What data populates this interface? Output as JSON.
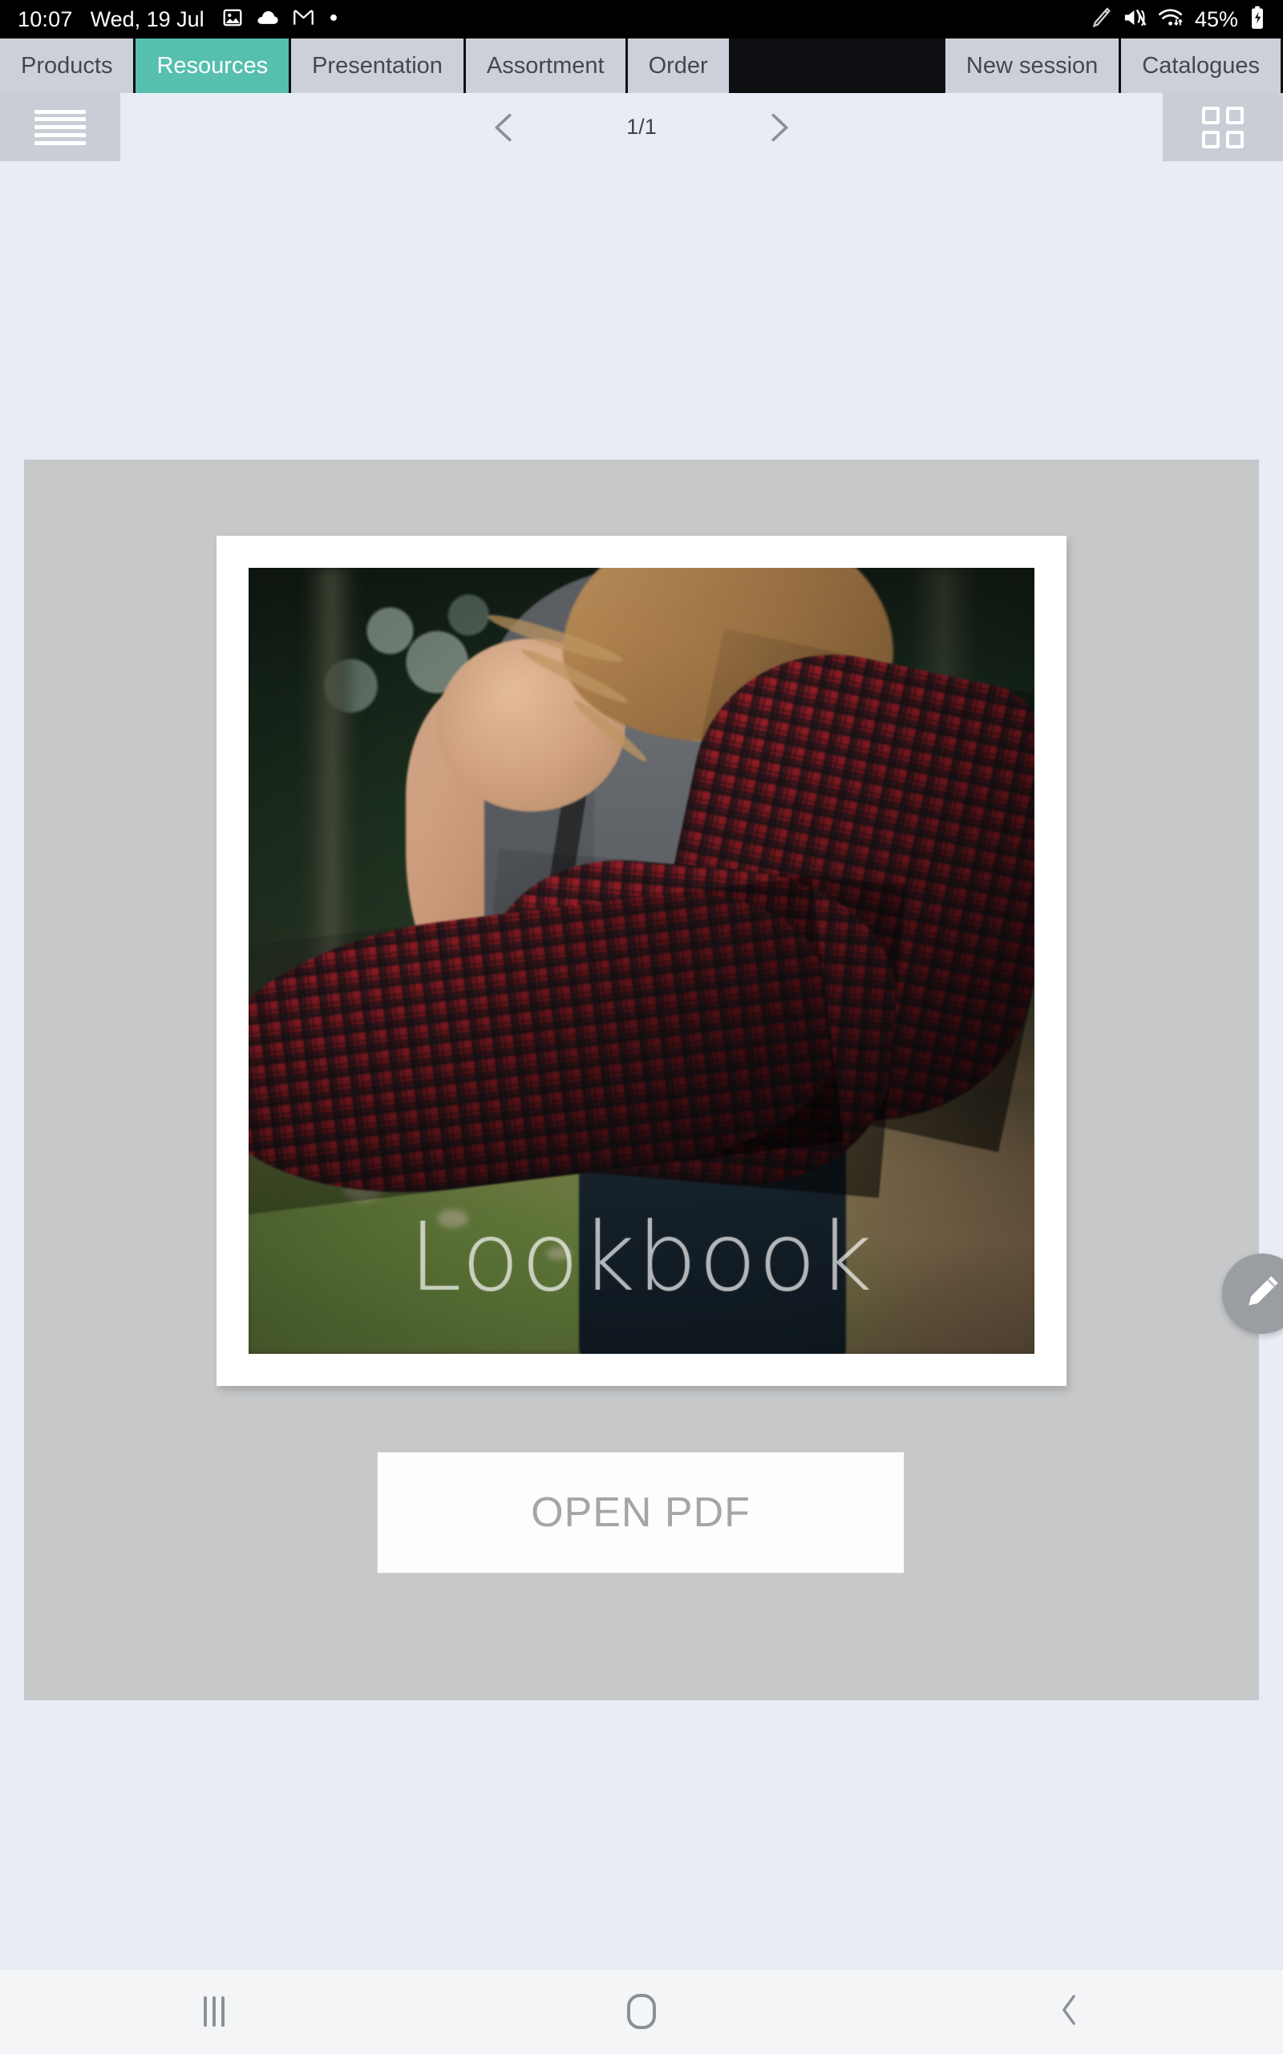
{
  "status_bar": {
    "time": "10:07",
    "date": "Wed, 19 Jul",
    "notification_icons": [
      "image-icon",
      "cloud-icon",
      "gmail-icon",
      "dot-icon"
    ],
    "right_icons": [
      "stylus-icon",
      "mute-vibrate-icon",
      "wifi-icon"
    ],
    "battery_percent": "45%",
    "battery_state": "charging"
  },
  "tabs": {
    "left": [
      {
        "label": "Products",
        "active": false
      },
      {
        "label": "Resources",
        "active": true
      },
      {
        "label": "Presentation",
        "active": false
      },
      {
        "label": "Assortment",
        "active": false
      },
      {
        "label": "Order",
        "active": false
      }
    ],
    "right": [
      {
        "label": "New session"
      },
      {
        "label": "Catalogues"
      }
    ],
    "active_color": "#56bfae",
    "inactive_color": "#ccd1d9"
  },
  "toolbar": {
    "menu_icon": "hamburger-list-icon",
    "prev_icon": "chevron-left-icon",
    "next_icon": "chevron-right-icon",
    "page_indicator": "1/1",
    "grid_icon": "grid-view-icon"
  },
  "content": {
    "cover_title": "Lookbook",
    "open_pdf_label": "OPEN PDF",
    "card_background": "#c6c8ca",
    "page_background": "#e8ecf4"
  },
  "fab": {
    "icon": "pencil-edit-icon",
    "color": "#9a9da1"
  },
  "bottom_nav": {
    "recents_icon": "recents-icon",
    "home_icon": "home-icon",
    "back_icon": "back-icon"
  }
}
